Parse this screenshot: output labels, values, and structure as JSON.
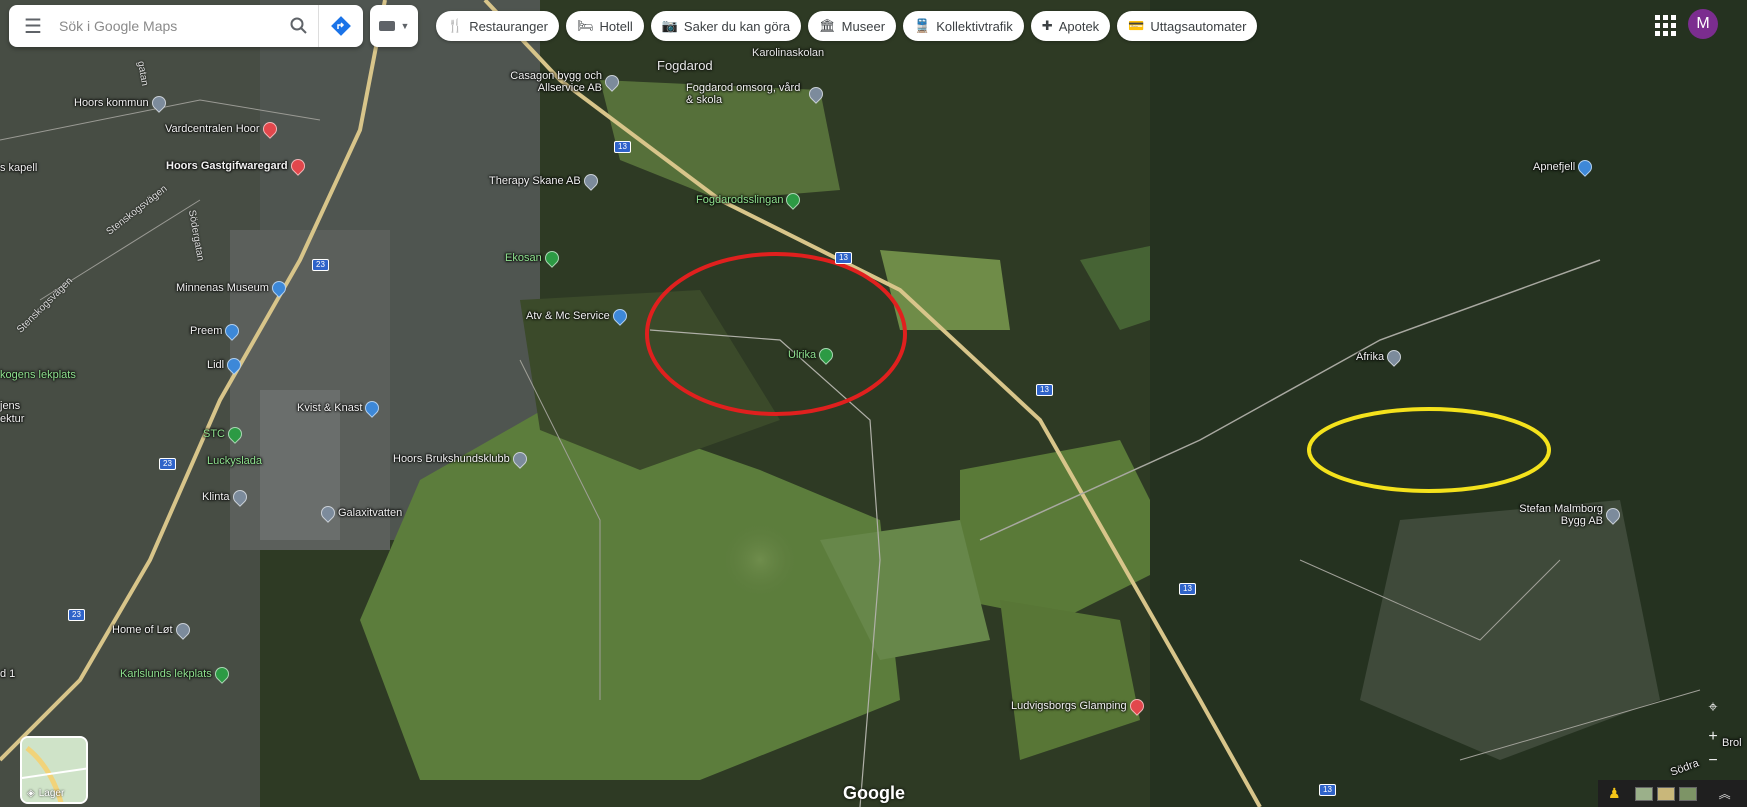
{
  "search": {
    "placeholder": "Sök i Google Maps"
  },
  "chips": [
    {
      "icon": "restaurant-icon",
      "glyph": "🍴",
      "label": "Restauranger"
    },
    {
      "icon": "hotel-icon",
      "glyph": "🛏",
      "label": "Hotell"
    },
    {
      "icon": "camera-icon",
      "glyph": "📷",
      "label": "Saker du kan göra"
    },
    {
      "icon": "museum-icon",
      "glyph": "🏛",
      "label": "Museer"
    },
    {
      "icon": "transit-icon",
      "glyph": "🚆",
      "label": "Kollektivtrafik"
    },
    {
      "icon": "pharmacy-icon",
      "glyph": "✚",
      "label": "Apotek"
    },
    {
      "icon": "atm-icon",
      "glyph": "💳",
      "label": "Uttagsautomater"
    }
  ],
  "account": {
    "initial": "M"
  },
  "places": {
    "karolinaskolan": "Karolinaskolan",
    "fogdarod": "Fogdarod",
    "casagon": "Casagon bygg och Allservice AB",
    "fogdarod_omsorg": "Fogdarod omsorg, vård & skola",
    "hoors_kommun": "Hoors kommun",
    "vardcentralen": "Vardcentralen Hoor",
    "gastgifvaregard": "Hoors Gastgifwaregard",
    "kapell": "s kapell",
    "therapy": "Therapy Skane AB",
    "fogdarodsslingan": "Fogdarodsslingan",
    "ekosan": "Ekosan",
    "minnenas": "Minnenas Museum",
    "atv": "Atv & Mc Service",
    "preem": "Preem",
    "lidl": "Lidl",
    "ulrika": "Ulrika",
    "lekplats": "kogens lekplats",
    "kvist": "Kvist & Knast",
    "stc": "STC",
    "luckyslada": "Luckyslada",
    "brukshund": "Hoors Brukshundsklubb",
    "klinta": "Klinta",
    "galaxi": "Galaxitvatten",
    "home_of_lot": "Home of Løt",
    "karlslunds": "Karlslunds lekplats",
    "apnefjell": "Apnefjell",
    "afrika": "Afrika",
    "stefan": "Stefan Malmborg Bygg AB",
    "ludvigsborgs": "Ludvigsborgs Glamping",
    "lektur": "ektur",
    "jens": "jens",
    "road_1": "d 1",
    "brol": "Brol",
    "sodra": "Södra"
  },
  "roads": {
    "stenskogsvagen_a": "Stenskogsvägen",
    "stenskogsvagen_b": "Stenskogsvägen",
    "sodergatan": "Södergatan",
    "gatan": "gatan"
  },
  "road_numbers": [
    "13",
    "13",
    "13",
    "13",
    "23",
    "23",
    "23",
    "13"
  ],
  "layers_label": "Lager",
  "google_logo": "Google",
  "annotations": {
    "red_circle": "red",
    "yellow_circle": "yellow"
  }
}
